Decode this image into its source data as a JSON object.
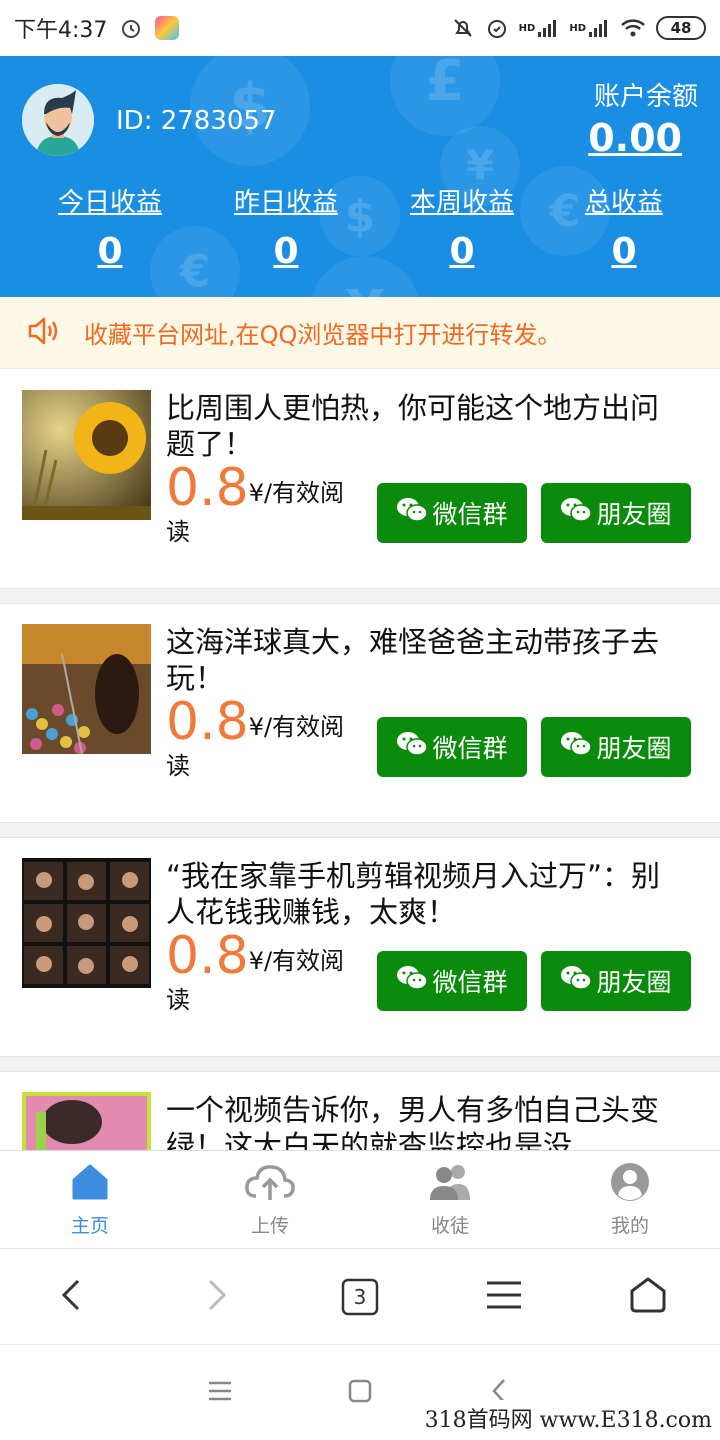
{
  "status_bar": {
    "time": "下午4:37",
    "signal_tag_1": "HD",
    "signal_tag_2": "HD",
    "battery": "48"
  },
  "header": {
    "user_id": "ID: 2783057",
    "balance_label": "账户余额",
    "balance_value": "0.00",
    "stats": [
      {
        "label": "今日收益",
        "value": "0"
      },
      {
        "label": "昨日收益",
        "value": "0"
      },
      {
        "label": "本周收益",
        "value": "0"
      },
      {
        "label": "总收益",
        "value": "0"
      }
    ],
    "background_color": "#1a8ee3"
  },
  "notice": {
    "icon": "speaker-icon",
    "text": "收藏平台网址,在QQ浏览器中打开进行转发。"
  },
  "articles": [
    {
      "title": "比周围人更怕热，你可能这个地方出问题了！",
      "price": "0.8",
      "unit": "¥/有效阅读",
      "wechat_group_label": "微信群",
      "moments_label": "朋友圈"
    },
    {
      "title": "这海洋球真大，难怪爸爸主动带孩子去玩！",
      "price": "0.8",
      "unit": "¥/有效阅读",
      "wechat_group_label": "微信群",
      "moments_label": "朋友圈"
    },
    {
      "title": "“我在家靠手机剪辑视频月入过万”：别人花钱我赚钱，太爽！",
      "price": "0.8",
      "unit": "¥/有效阅读",
      "wechat_group_label": "微信群",
      "moments_label": "朋友圈"
    },
    {
      "title": "一个视频告诉你，男人有多怕自己头变绿！这大白天的就査监控也是没"
    }
  ],
  "tabs": [
    {
      "label": "主页",
      "icon": "home-icon",
      "active": true
    },
    {
      "label": "上传",
      "icon": "cloud-upload-icon",
      "active": false
    },
    {
      "label": "收徒",
      "icon": "users-icon",
      "active": false
    },
    {
      "label": "我的",
      "icon": "user-icon",
      "active": false
    }
  ],
  "browser_nav": {
    "tab_count": "3"
  },
  "watermark": "318首码网  www.E318.com",
  "colors": {
    "accent_blue": "#1a8ee3",
    "button_green": "#0b8b0b",
    "price_orange": "#f07a3a",
    "notice_text": "#f06a24",
    "tab_active": "#3d8ce0"
  }
}
